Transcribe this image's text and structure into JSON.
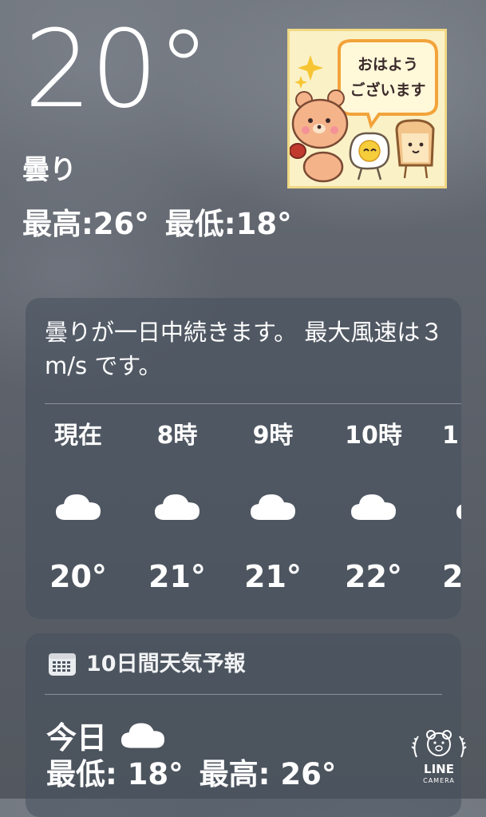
{
  "current": {
    "temperature": "20°",
    "condition": "曇り",
    "high": "最高:26°",
    "low": "最低:18°"
  },
  "sticker": {
    "greeting_line1": "おはよう",
    "greeting_line2": "ございます"
  },
  "hourly": {
    "summary": "曇りが一日中続きます。 最大風速は３ m/s です。",
    "items": [
      {
        "time": "現在",
        "icon": "cloud-icon",
        "temp": "20°"
      },
      {
        "time": "8時",
        "icon": "cloud-icon",
        "temp": "21°"
      },
      {
        "time": "9時",
        "icon": "cloud-icon",
        "temp": "21°"
      },
      {
        "time": "10時",
        "icon": "cloud-icon",
        "temp": "22°"
      },
      {
        "time": "1",
        "icon": "cloud-icon",
        "temp": "2"
      }
    ]
  },
  "ten_day": {
    "title": "10日間天気予報",
    "icon": "calendar-icon",
    "today": {
      "day": "今日",
      "icon": "cloud-icon",
      "low": "最低: 18°",
      "high": "最高: 26°"
    }
  },
  "watermark": {
    "brand": "LINE",
    "sub": "CAMERA"
  },
  "colors": {
    "sky": "#5d626b",
    "card": "#46505c",
    "text": "#ffffff"
  }
}
